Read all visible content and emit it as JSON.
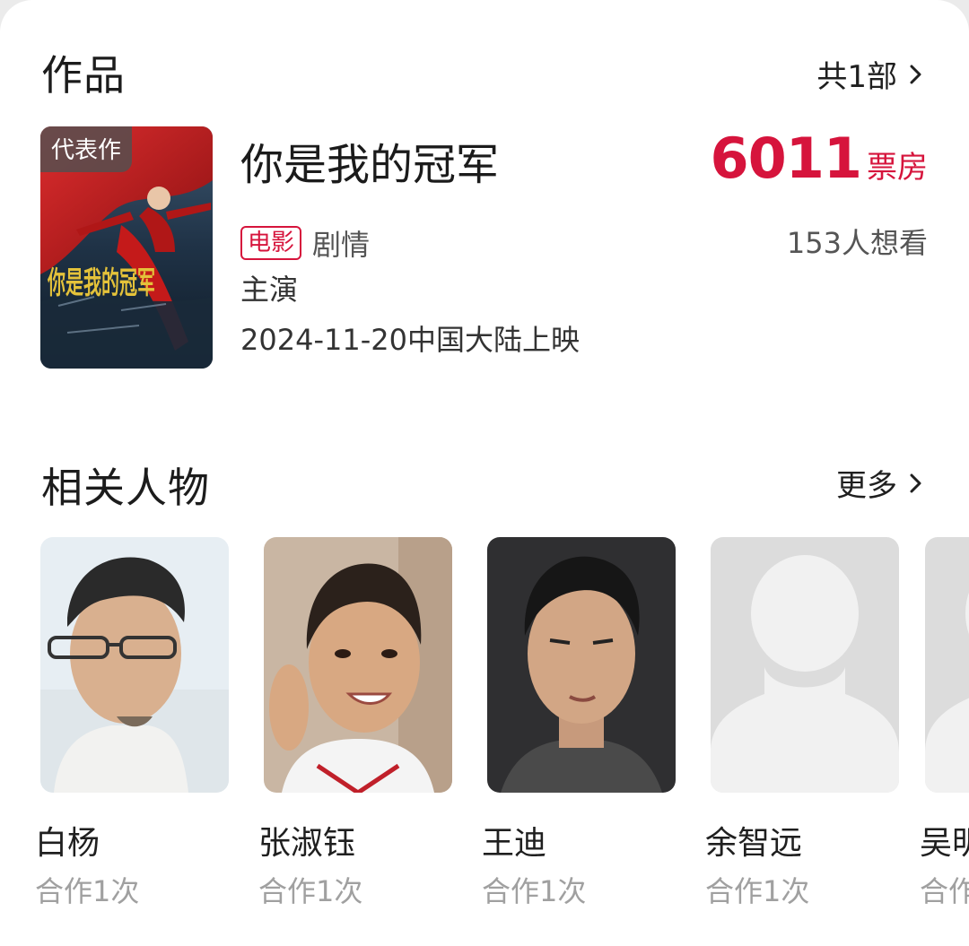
{
  "works": {
    "title": "作品",
    "count_link": "共1部",
    "movie": {
      "badge": "代表作",
      "poster_text": "你是我的冠军",
      "name": "你是我的冠军",
      "box_office": "6011",
      "box_office_unit": "票房",
      "type_tag": "电影",
      "genre": "剧情",
      "want_to_see": "153人想看",
      "role": "主演",
      "release": "2024-11-20中国大陆上映"
    }
  },
  "related": {
    "title": "相关人物",
    "more_link": "更多",
    "people": [
      {
        "name": "白杨",
        "count": "合作1次"
      },
      {
        "name": "张淑钰",
        "count": "合作1次"
      },
      {
        "name": "王迪",
        "count": "合作1次"
      },
      {
        "name": "余智远",
        "count": "合作1次"
      },
      {
        "name": "吴明",
        "count": "合作"
      }
    ]
  },
  "colors": {
    "accent": "#d6143c",
    "muted_text": "#a0a0a0",
    "secondary_text": "#555555"
  }
}
